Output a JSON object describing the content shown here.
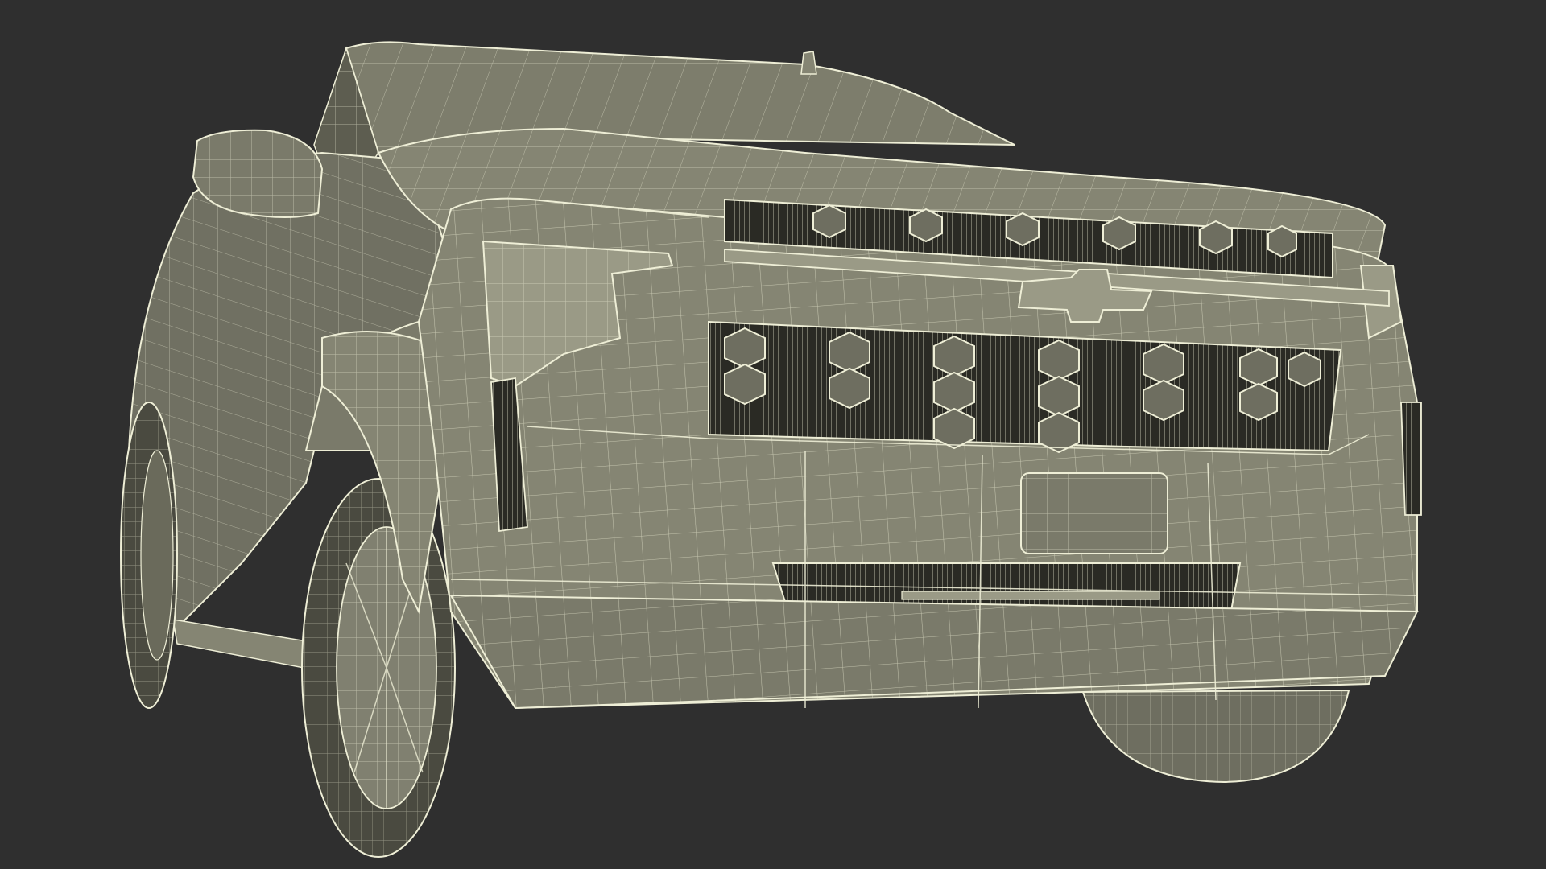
{
  "scene": {
    "subject_icon": "suv-wireframe-render",
    "colors": {
      "background": "#2f2f2f",
      "surface": "#858573",
      "surface_shadow": "#5d5d50",
      "surface_dark": "#3a3a33",
      "wire": "#eeeed6",
      "wire_soft": "#c9c9b0"
    }
  }
}
